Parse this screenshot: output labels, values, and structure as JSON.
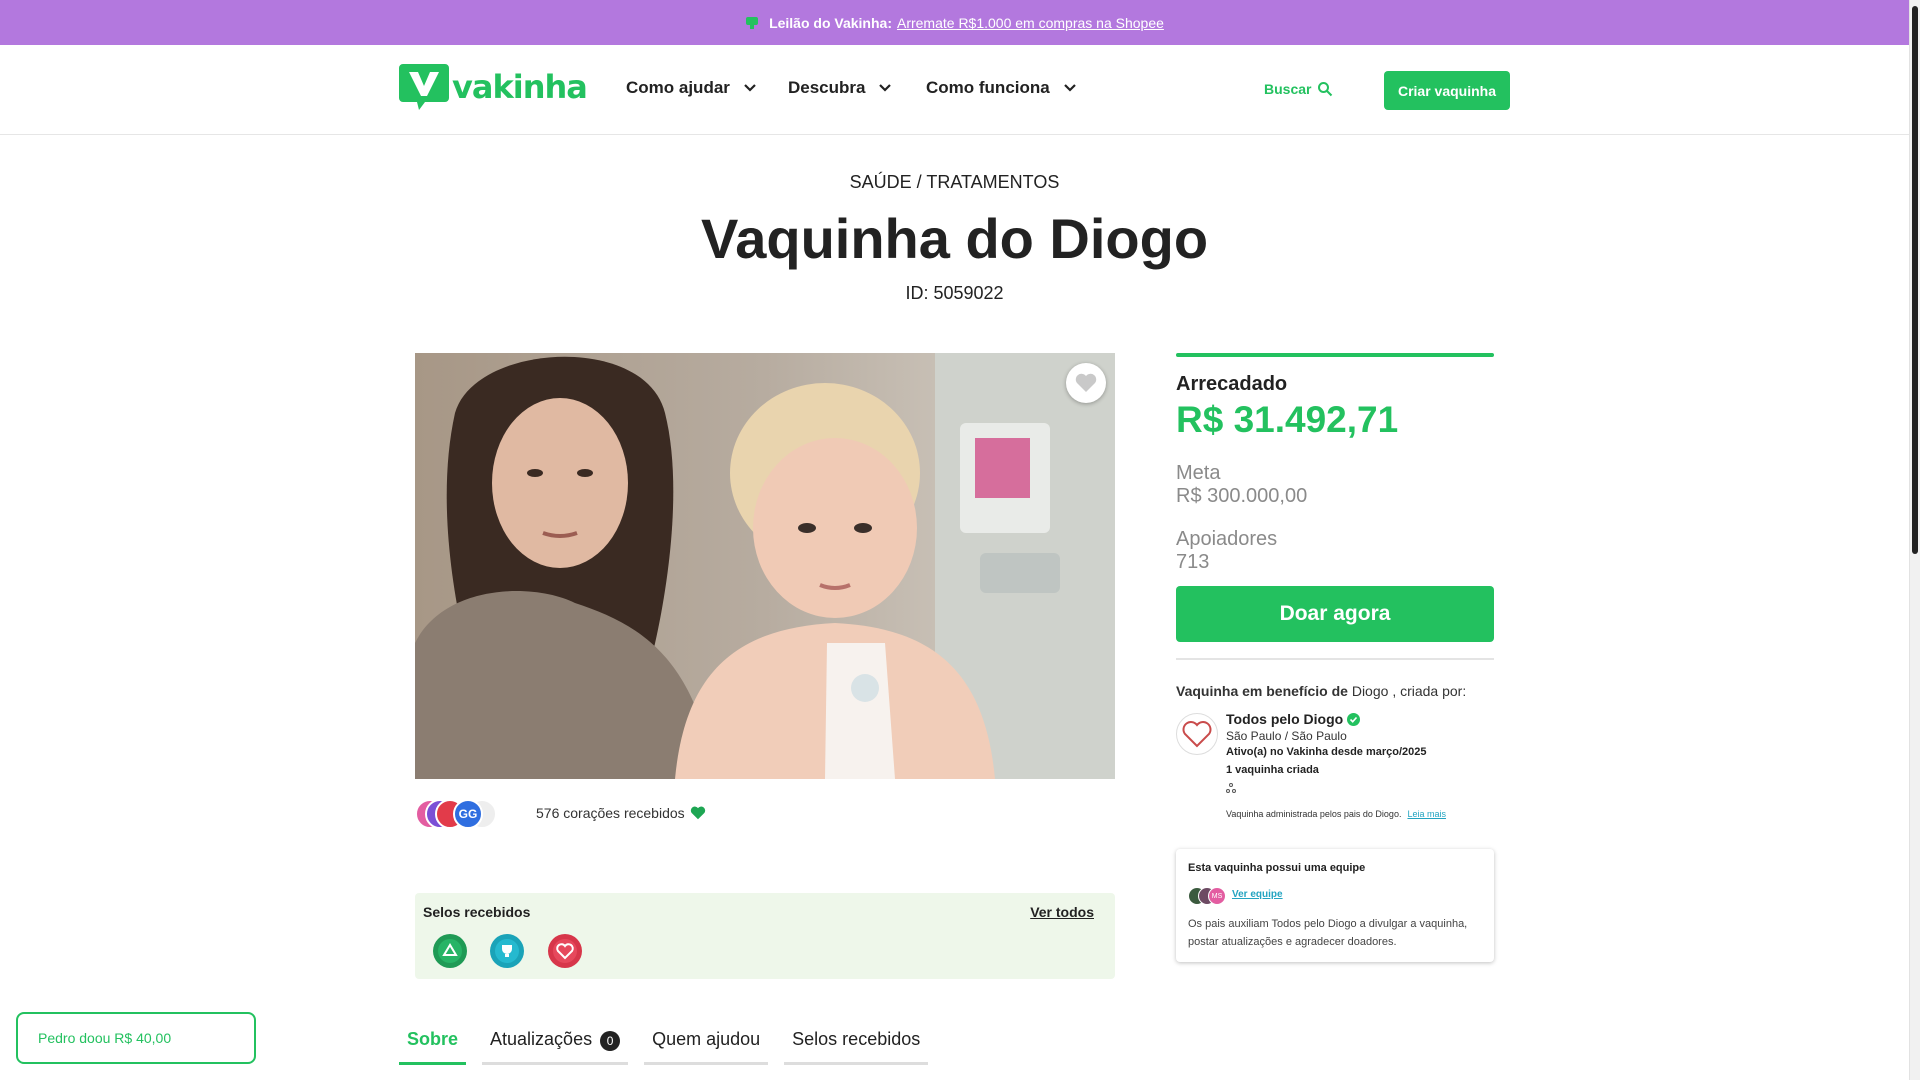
{
  "promo": {
    "bold": "Leilão do Vakinha:",
    "link": "Arremate R$1.000 em compras na Shopee"
  },
  "header": {
    "logo_text": "vakinha",
    "nav": [
      "Como ajudar",
      "Descubra",
      "Como funciona"
    ],
    "search_label": "Buscar",
    "create_label": "Criar vaquinha"
  },
  "campaign": {
    "category": "SAÚDE / TRATAMENTOS",
    "title": "Vaquinha do Diogo",
    "id_text": "ID: 5059022",
    "hearts_text": "576 corações recebidos",
    "supporter_initials": [
      "GG"
    ]
  },
  "seals": {
    "label": "Selos recebidos",
    "see_all": "Ver todos"
  },
  "tabs": [
    {
      "label": "Sobre"
    },
    {
      "label": "Atualizações",
      "count": "0"
    },
    {
      "label": "Quem ajudou"
    },
    {
      "label": "Selos recebidos"
    }
  ],
  "toast": "Pedro doou R$ 40,00",
  "stats": {
    "raised_label": "Arrecadado",
    "raised_value": "R$ 31.492,71",
    "goal_label": "Meta",
    "goal_value": "R$ 300.000,00",
    "supporters_label": "Apoiadores",
    "supporters_value": "713",
    "donate_label": "Doar agora"
  },
  "creator": {
    "beneficiary_prefix": "Vaquinha em benefício de",
    "beneficiary_name": "Diogo",
    "beneficiary_suffix": ", criada por:",
    "name": "Todos pelo Diogo",
    "location": "São Paulo / São Paulo",
    "since": "Ativo(a) no Vakinha desde março/2025",
    "count": "1 vaquinha criada",
    "admin_text": "Vaquinha administrada pelos pais do Diogo.",
    "read_more": "Leia mais"
  },
  "team": {
    "title": "Esta vaquinha possui uma equipe",
    "member_initials": "MS",
    "link": "Ver equipe",
    "description": "Os pais auxiliam Todos pelo Diogo a divulgar a vaquinha, postar atualizações e agradecer doadores."
  },
  "colors": {
    "brand_green": "#23c15f",
    "promo_purple": "#b378de",
    "seal_bg": "#eef7ea"
  }
}
